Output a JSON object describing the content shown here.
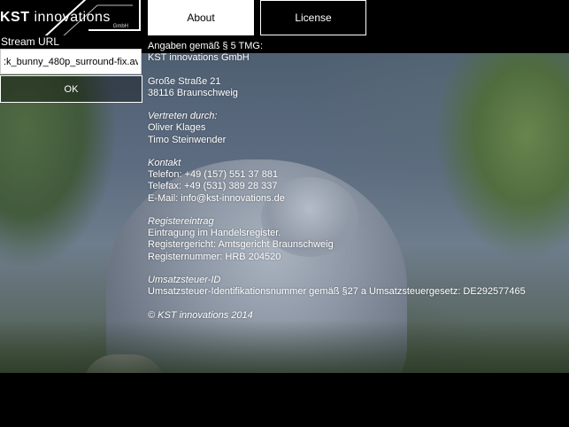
{
  "logo": {
    "brand_bold": "KST",
    "brand_thin": " innovations",
    "sub": "GmbH"
  },
  "header": {
    "about_label": "About",
    "license_label": "License"
  },
  "stream": {
    "label": "Stream URL",
    "value": ":k_bunny_480p_surround-fix.avi",
    "ok_label": "OK"
  },
  "imprint": {
    "intro": "Angaben gemäß § 5 TMG:",
    "company": "KST innovations GmbH",
    "street": "Große Straße 21",
    "city": "38116 Braunschweig",
    "rep_heading": "Vertreten durch:",
    "rep_1": "Oliver Klages",
    "rep_2": "Timo Steinwender",
    "contact_heading": "Kontakt",
    "phone": "Telefon: +49 (157) 551 37 881",
    "fax": "Telefax: +49 (531) 389 28 337",
    "email": "E-Mail: info@kst-innovations.de",
    "register_heading": "Registereintrag",
    "register_1": "Eintragung im Handelsregister.",
    "register_2": "Registergericht: Amtsgericht Braunschweig",
    "register_3": "Registernummer: HRB 204520",
    "vat_heading": "Umsatzsteuer-ID",
    "vat_line": "Umsatzsteuer-Identifikationsnummer gemäß §27 a Umsatzsteuergesetz: DE292577465",
    "copyright": "© KST innovations 2014"
  }
}
